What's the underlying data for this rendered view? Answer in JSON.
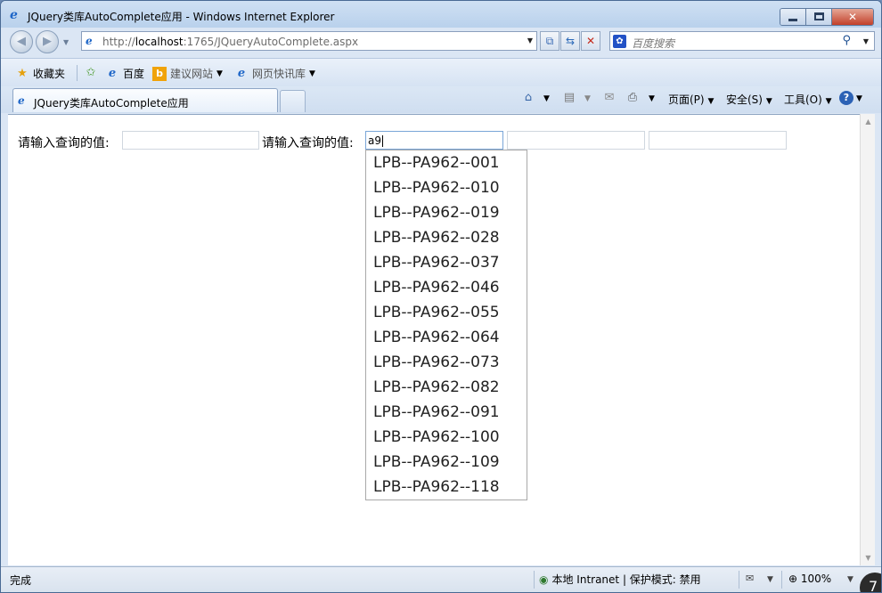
{
  "window": {
    "title": "JQuery类库AutoComplete应用 - Windows Internet Explorer",
    "close_glyph": "✕"
  },
  "address": {
    "url_prefix": "http://",
    "url_host": "localhost",
    "url_rest": ":1765/JQueryAutoComplete.aspx",
    "search_placeholder": "百度搜索"
  },
  "favorites": {
    "label": "收藏夹",
    "items": [
      "百度",
      "建议网站",
      "网页快讯库"
    ]
  },
  "tabs": {
    "active_label": "JQuery类库AutoComplete应用"
  },
  "commands": {
    "page": "页面(P)",
    "safety": "安全(S)",
    "tools": "工具(O)"
  },
  "form": {
    "label1": "请输入查询的值:",
    "label2": "请输入查询的值:",
    "input1_value": "",
    "input2_value": "a9",
    "input3_value": "",
    "input4_value": ""
  },
  "autocomplete": {
    "items": [
      "LPB--PA962--001",
      "LPB--PA962--010",
      "LPB--PA962--019",
      "LPB--PA962--028",
      "LPB--PA962--037",
      "LPB--PA962--046",
      "LPB--PA962--055",
      "LPB--PA962--064",
      "LPB--PA962--073",
      "LPB--PA962--082",
      "LPB--PA962--091",
      "LPB--PA962--100",
      "LPB--PA962--109",
      "LPB--PA962--118"
    ]
  },
  "status": {
    "text": "完成",
    "zone": "本地 Intranet | 保护模式: 禁用",
    "zoom": "100%",
    "corner_digit": "7"
  },
  "colors": {
    "accent": "#1e66c8",
    "close_button": "#c2402a"
  }
}
